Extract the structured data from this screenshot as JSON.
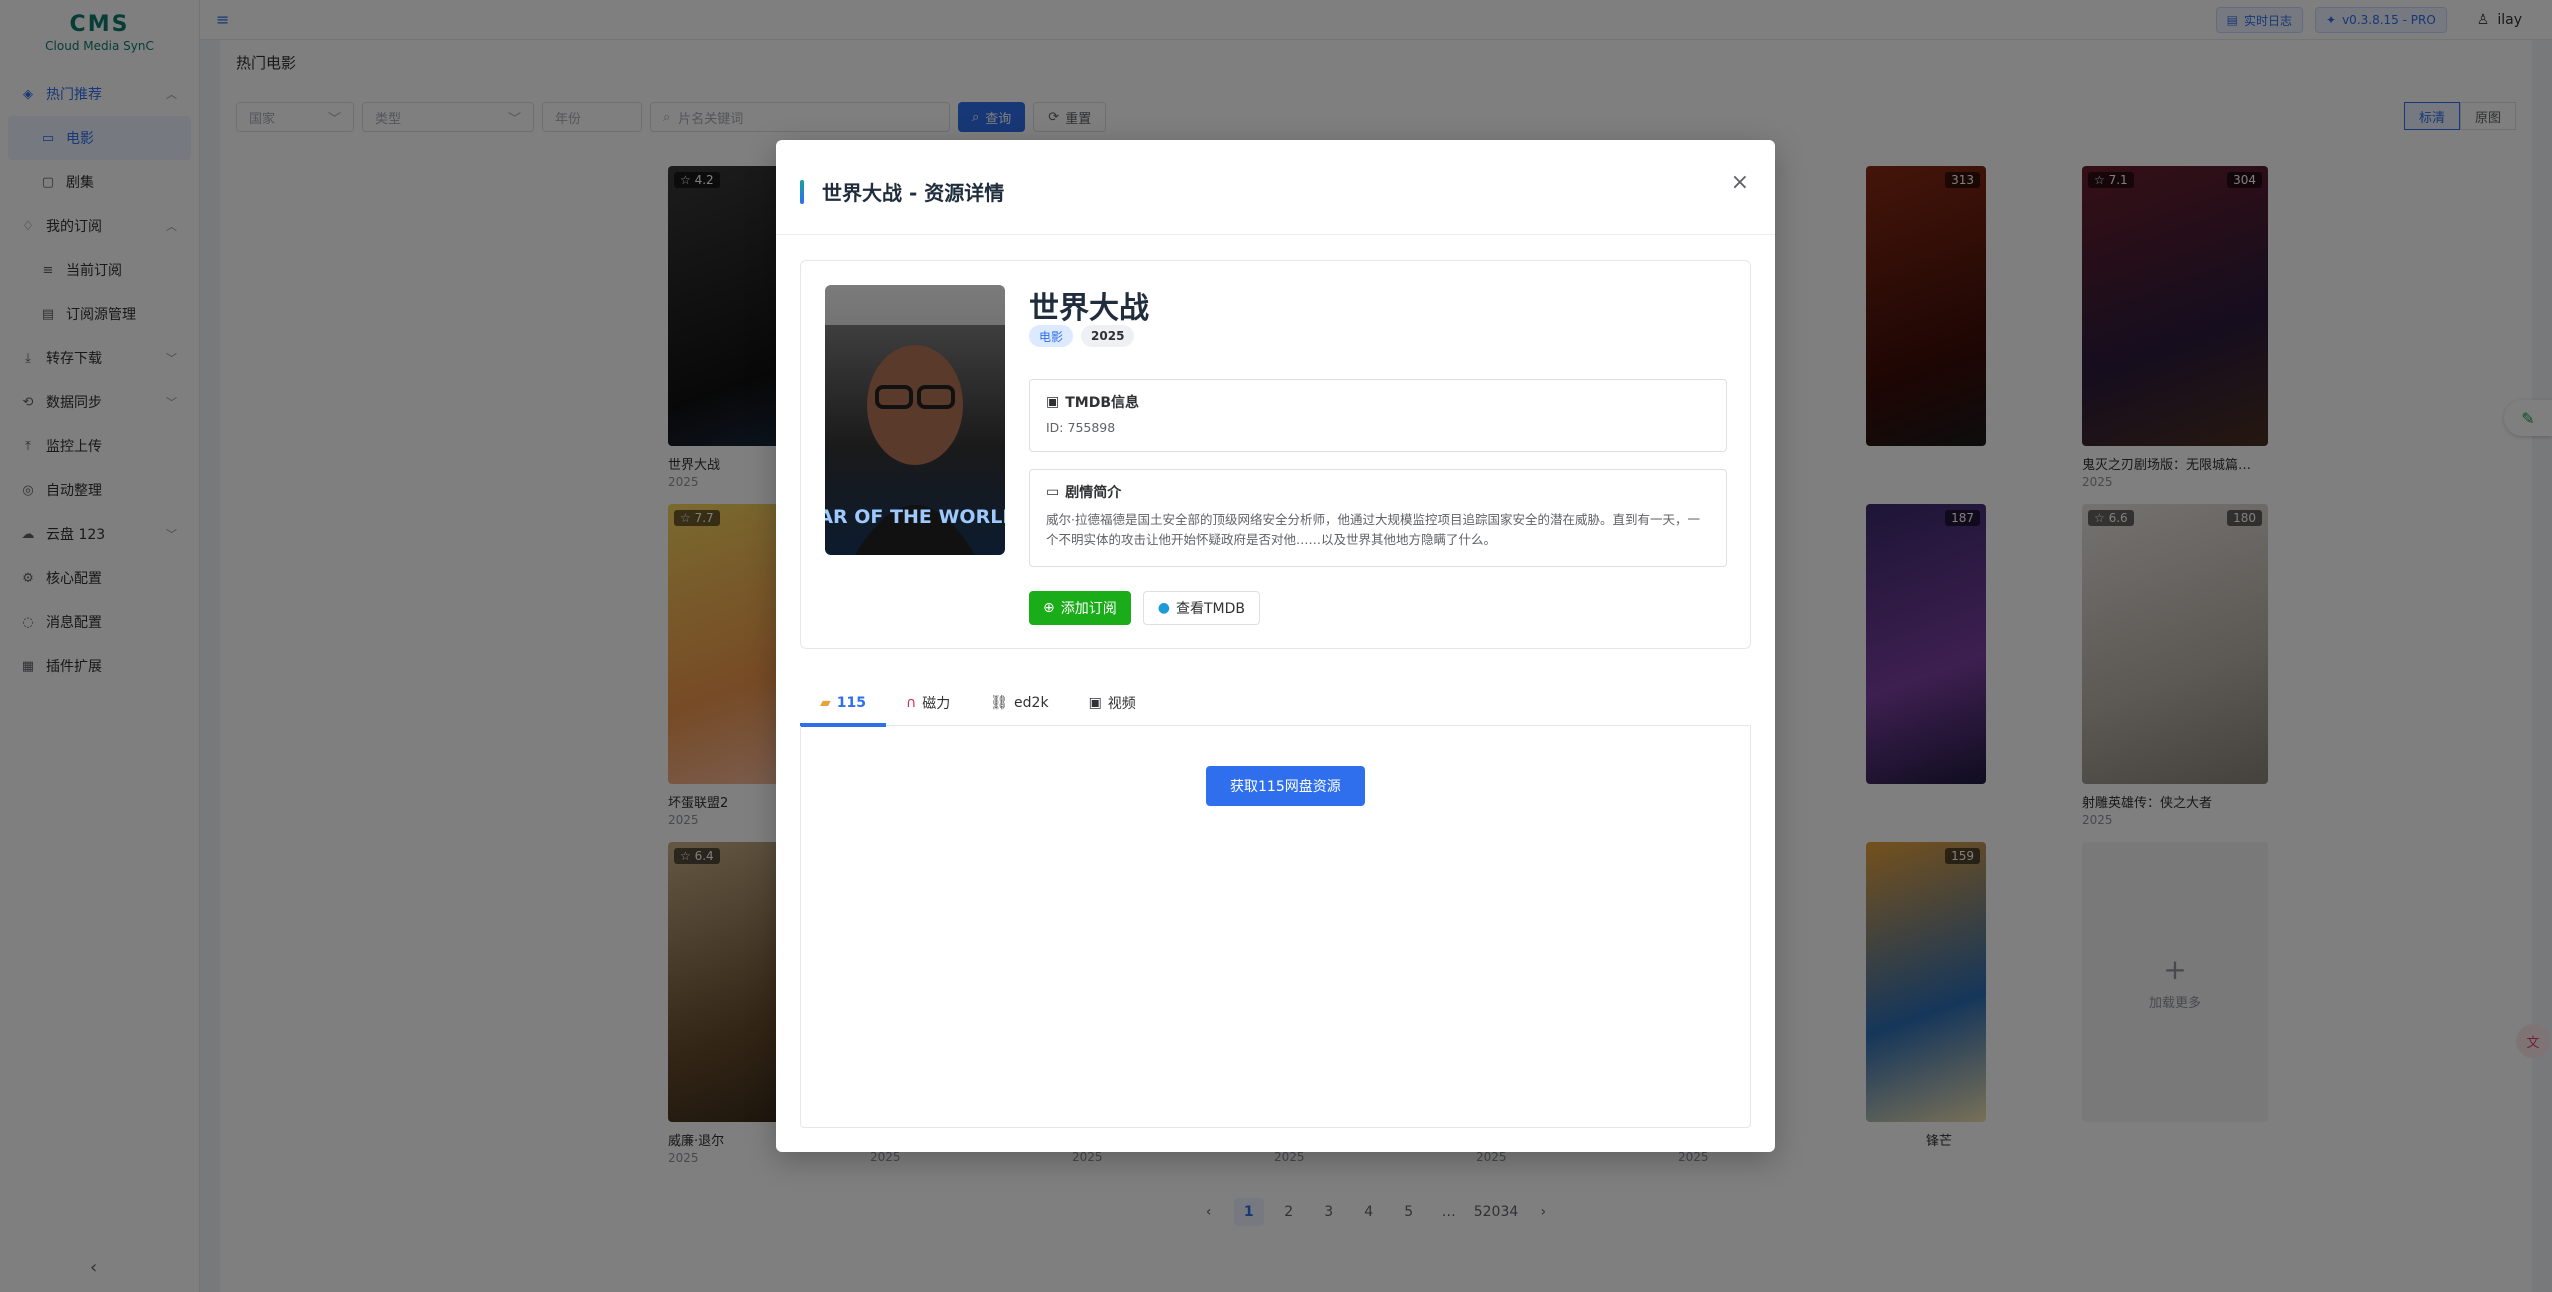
{
  "app": {
    "logo": "CMS",
    "subtitle": "Cloud Media SynC"
  },
  "sidebar": {
    "items": [
      {
        "label": "热门推荐",
        "icon": "flame-icon"
      },
      {
        "label": "电影",
        "icon": "video-icon"
      },
      {
        "label": "剧集",
        "icon": "tv-icon"
      },
      {
        "label": "我的订阅",
        "icon": "bell-icon"
      },
      {
        "label": "当前订阅",
        "icon": "list-icon"
      },
      {
        "label": "订阅源管理",
        "icon": "rss-icon"
      },
      {
        "label": "转存下载",
        "icon": "download-icon"
      },
      {
        "label": "数据同步",
        "icon": "sync-icon"
      },
      {
        "label": "监控上传",
        "icon": "upload-icon"
      },
      {
        "label": "自动整理",
        "icon": "organize-icon"
      },
      {
        "label": "云盘 123",
        "icon": "cloud-icon"
      },
      {
        "label": "核心配置",
        "icon": "gear-icon"
      },
      {
        "label": "消息配置",
        "icon": "message-icon"
      },
      {
        "label": "插件扩展",
        "icon": "plugin-icon"
      }
    ]
  },
  "header": {
    "log_label": "实时日志",
    "version": "v0.3.8.15 - PRO",
    "user": "ilay"
  },
  "page": {
    "title": "热门电影",
    "filters": {
      "country": "国家",
      "type": "类型",
      "year": "年份",
      "keyword_placeholder": "片名关键词",
      "search": "查询",
      "reset": "重置"
    },
    "view": {
      "standard": "标清",
      "original": "原图"
    }
  },
  "grid": [
    {
      "title": "世界大战",
      "year": "2025",
      "rating": "4.2"
    },
    {
      "title": "",
      "year": "",
      "votes": "313"
    },
    {
      "title": "鬼灭之刃剧场版：无限城篇…",
      "year": "2025",
      "rating": "7.1",
      "votes": "304"
    },
    {
      "title": "坏蛋联盟2",
      "year": "2025",
      "rating": "7.7"
    },
    {
      "title": "",
      "year": "",
      "votes": "187"
    },
    {
      "title": "射雕英雄传：侠之大者",
      "year": "2025",
      "rating": "6.6",
      "votes": "180"
    },
    {
      "title": "威廉·退尔",
      "year": "2025",
      "rating": "6.4"
    },
    {
      "title": "锋芒",
      "year": "",
      "votes": "159"
    }
  ],
  "years_bottom": [
    "2025",
    "2025",
    "2025",
    "2025",
    "2025"
  ],
  "load_more": "加载更多",
  "pagination": [
    "1",
    "2",
    "3",
    "4",
    "5",
    "…",
    "52034"
  ],
  "modal": {
    "title": "世界大战 - 资源详情",
    "movie_title": "世界大战",
    "tags": [
      "电影",
      "2025"
    ],
    "tmdb_title": "TMDB信息",
    "tmdb_id": "ID: 755898",
    "overview_title": "剧情简介",
    "overview": "威尔·拉德福德是国土安全部的顶级网络安全分析师，他通过大规模监控项目追踪国家安全的潜在威胁。直到有一天，一个不明实体的攻击让他开始怀疑政府是否对他……以及世界其他地方隐瞒了什么。",
    "subscribe_label": "添加订阅",
    "tmdb_link_label": "查看TMDB",
    "tabs": [
      "115",
      "磁力",
      "ed2k",
      "视频"
    ],
    "fetch_label": "获取115网盘资源",
    "poster_text": "WAR OF THE WORLDS"
  }
}
